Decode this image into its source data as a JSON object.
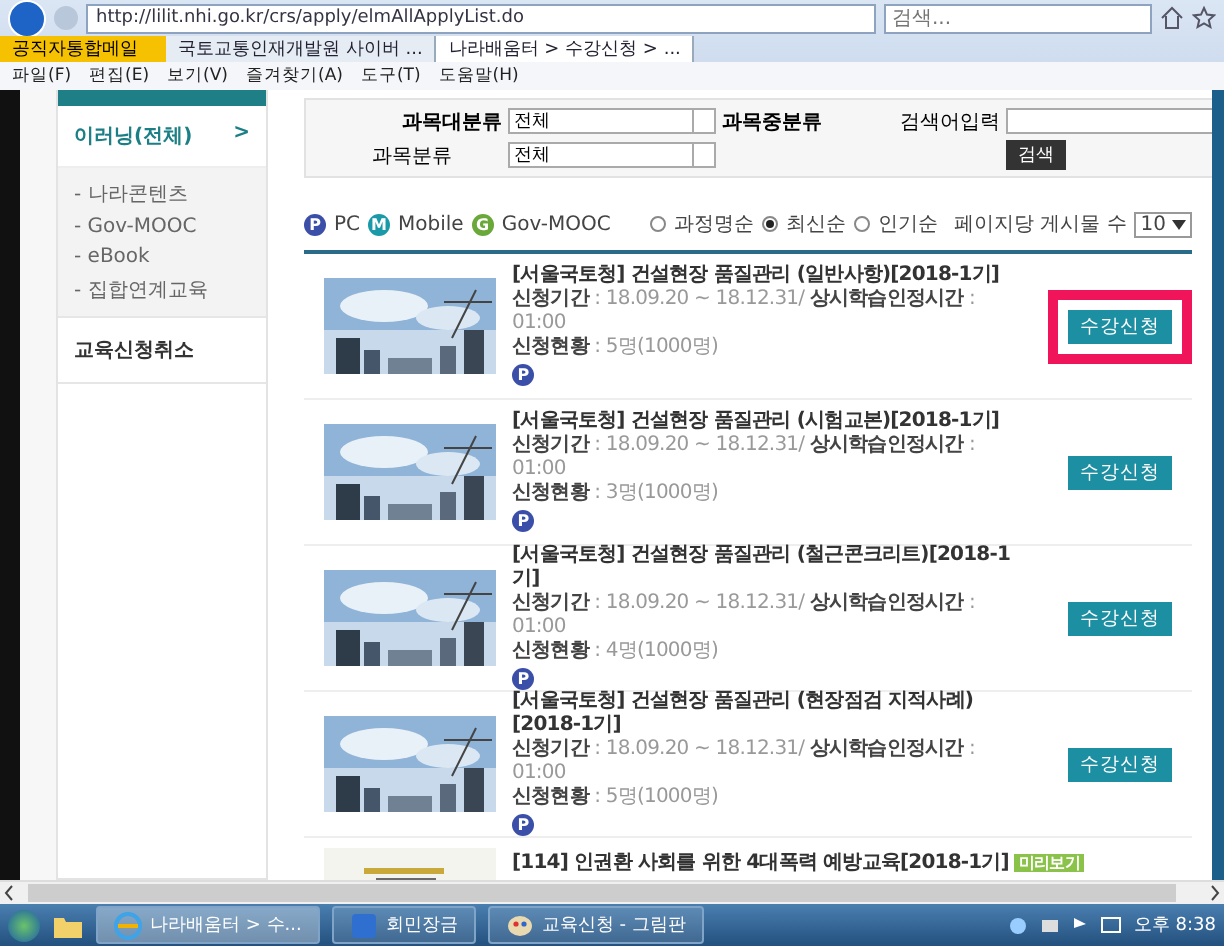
{
  "browser": {
    "url": "http://lilit.nhi.go.kr/crs/apply/elmAllApplyList.do",
    "search": {
      "placeholder": "검색..."
    },
    "favorites": [
      {
        "label": "공직자통합메일"
      }
    ],
    "tabs": [
      {
        "label": "국토교통인재개발원 사이버 ...",
        "selected": false
      },
      {
        "label": "나라배움터 > 수강신청 > ...",
        "selected": true
      }
    ],
    "menu": [
      "파일(F)",
      "편집(E)",
      "보기(V)",
      "즐겨찾기(A)",
      "도구(T)",
      "도움말(H)"
    ]
  },
  "sidebar": {
    "header": "이러닝(전체)",
    "header_arrow": ">",
    "items": [
      "- 나라콘텐츠",
      "- Gov-MOOC",
      "- eBook",
      "- 집합연계교육"
    ],
    "links": [
      "교육신청취소"
    ]
  },
  "filter": {
    "major_label": "과목대분류",
    "major_value": "전체",
    "middle_label": "과목중분류",
    "category_label": "과목분류",
    "category_value": "전체",
    "search_label": "검색어입력",
    "search_button": "검색"
  },
  "legend": [
    {
      "letter": "P",
      "label": "PC",
      "color": "#3b4fa8"
    },
    {
      "letter": "M",
      "label": "Mobile",
      "color": "#1a9aa8"
    },
    {
      "letter": "G",
      "label": "Gov-MOOC",
      "color": "#6aa83a"
    }
  ],
  "sort": [
    {
      "label": "과정명순",
      "selected": false
    },
    {
      "label": "최신순",
      "selected": true
    },
    {
      "label": "인기순",
      "selected": false
    }
  ],
  "page_size_label": "페이지당 게시물 수",
  "page_size": "10",
  "courses": [
    {
      "title": "[서울국토청] 건설현장 품질관리 (일반사항)[2018-1기]",
      "period_label": "신청기간",
      "period": " : 18.09.20 ~ 18.12.31/ ",
      "hours_label": "상시학습인정시간",
      "hours": " : 01:00",
      "status_label": "신청현황",
      "status": " : 5명(1000명)",
      "platform": "P",
      "button": "수강신청",
      "highlighted": true
    },
    {
      "title": "[서울국토청] 건설현장 품질관리 (시험교본)[2018-1기]",
      "period_label": "신청기간",
      "period": " : 18.09.20 ~ 18.12.31/ ",
      "hours_label": "상시학습인정시간",
      "hours": " : 01:00",
      "status_label": "신청현황",
      "status": " : 3명(1000명)",
      "platform": "P",
      "button": "수강신청",
      "highlighted": false
    },
    {
      "title": "[서울국토청] 건설현장 품질관리 (철근콘크리트)[2018-1기]",
      "period_label": "신청기간",
      "period": " : 18.09.20 ~ 18.12.31/ ",
      "hours_label": "상시학습인정시간",
      "hours": " : 01:00",
      "status_label": "신청현황",
      "status": " : 4명(1000명)",
      "platform": "P",
      "button": "수강신청",
      "highlighted": false
    },
    {
      "title": "[서울국토청] 건설현장 품질관리 (현장점검 지적사례)[2018-1기]",
      "period_label": "신청기간",
      "period": " : 18.09.20 ~ 18.12.31/ ",
      "hours_label": "상시학습인정시간",
      "hours": " : 01:00",
      "status_label": "신청현황",
      "status": " : 5명(1000명)",
      "platform": "P",
      "button": "수강신청",
      "highlighted": false
    }
  ],
  "partial_course": {
    "title": "[114] 인권환 사회를 위한 4대폭력 예방교육[2018-1기]",
    "badge": "미리보기"
  },
  "taskbar": {
    "items": [
      {
        "label": "나라배움터 > 수...",
        "kind": "browser",
        "selected": true
      },
      {
        "label": "회민장금",
        "kind": "app",
        "selected": false
      },
      {
        "label": "교육신청 - 그림판",
        "kind": "paint",
        "selected": false
      }
    ],
    "clock": "오후 8:38"
  }
}
